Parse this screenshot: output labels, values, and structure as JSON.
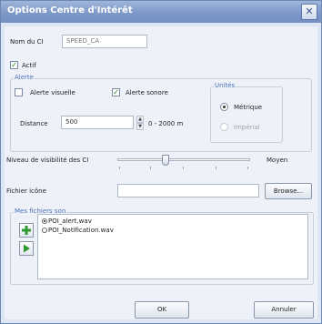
{
  "window": {
    "title": "Options Centre d'Intérêt",
    "close_label": "✕"
  },
  "ci_name": {
    "label": "Nom du CI",
    "value": "SPEED_CA"
  },
  "actif": {
    "label": "Actif",
    "checked": true
  },
  "alerte": {
    "title": "Alerte",
    "visuelle": {
      "label": "Alerte visuelle",
      "checked": false
    },
    "sonore": {
      "label": "Alerte sonore",
      "checked": true
    },
    "distance": {
      "label": "Distance",
      "value": "500",
      "range": "0 - 2000 m"
    }
  },
  "unites": {
    "title": "Unités",
    "options": [
      {
        "label": "Métrique",
        "selected": true
      },
      {
        "label": "Impérial",
        "selected": false
      }
    ]
  },
  "visibility": {
    "label": "Niveau de visibilité des CI",
    "value_label": "Moyen",
    "level": 0.36
  },
  "icon_file": {
    "label": "Fichier icône",
    "value": "",
    "browse_label": "Browse..."
  },
  "sound_files": {
    "title": "Mes fichiers son",
    "items": [
      {
        "label": "POI_alert.wav",
        "selected": true
      },
      {
        "label": "POI_Notification.wav",
        "selected": false
      }
    ],
    "add_icon": "plus-icon",
    "play_icon": "play-icon"
  },
  "footer": {
    "ok_label": "OK",
    "cancel_label": "Annuler"
  },
  "colors": {
    "titlebar": "#7e98c8",
    "group_title": "#4a6fb5",
    "add_green": "#2f9a2f"
  }
}
